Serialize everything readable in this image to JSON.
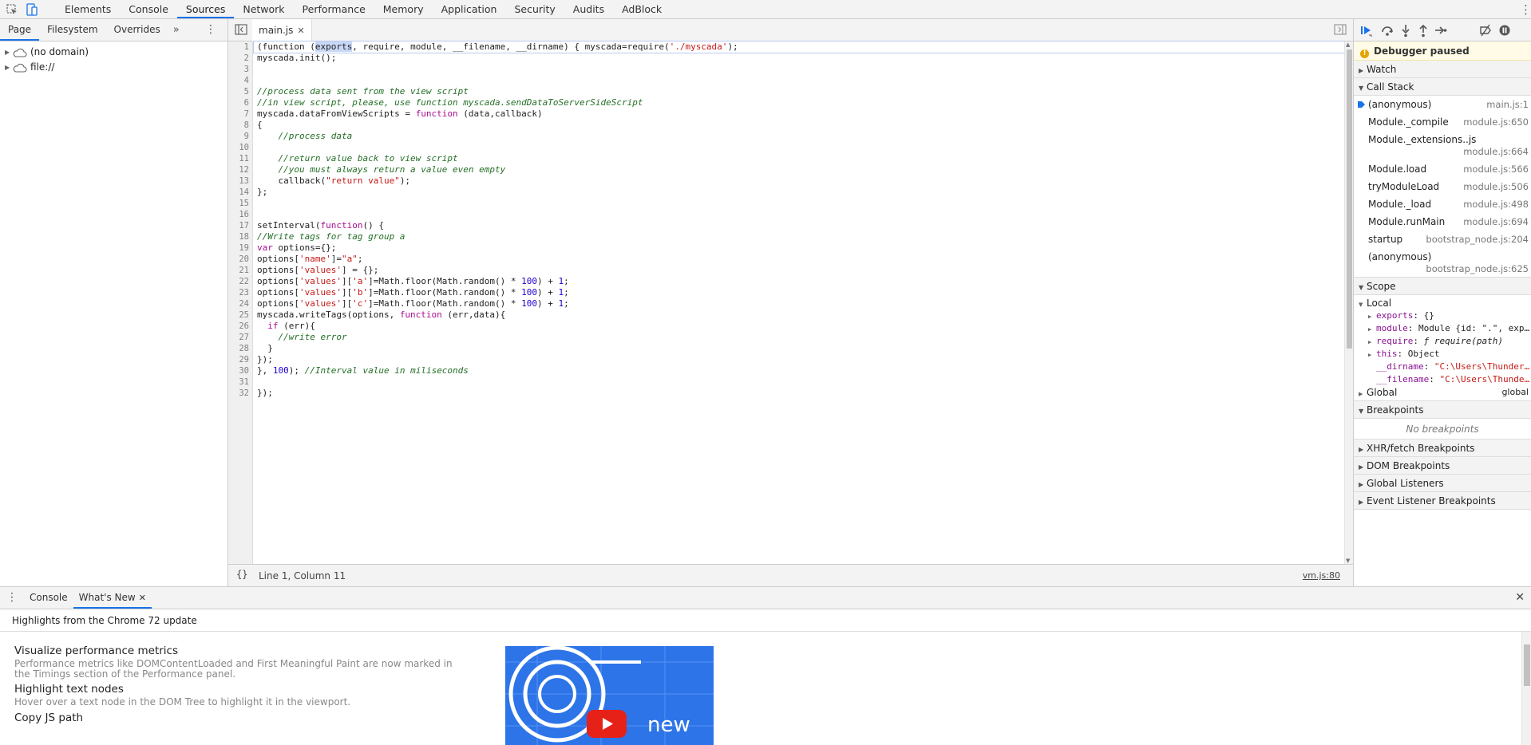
{
  "toolbar": {
    "tabs": [
      "Elements",
      "Console",
      "Sources",
      "Network",
      "Performance",
      "Memory",
      "Application",
      "Security",
      "Audits",
      "AdBlock"
    ],
    "active_tab": "Sources",
    "icons": [
      "inspect-element-icon",
      "device-toolbar-icon",
      "kebab-menu-icon"
    ]
  },
  "navigator": {
    "tabs": [
      "Page",
      "Filesystem",
      "Overrides"
    ],
    "more": "»",
    "items": [
      "(no domain)",
      "file://"
    ]
  },
  "editor": {
    "file_tab": "main.js",
    "status_position": "Line 1, Column 11",
    "status_braces": "{}",
    "status_link": "vm.js:80",
    "line_numbers": [
      "1",
      "2",
      "3",
      "4",
      "5",
      "6",
      "7",
      "8",
      "9",
      "10",
      "11",
      "12",
      "13",
      "14",
      "15",
      "16",
      "17",
      "18",
      "19",
      "20",
      "21",
      "22",
      "23",
      "24",
      "25",
      "26",
      "27",
      "28",
      "29",
      "30",
      "31",
      "32"
    ]
  },
  "code": {
    "l1a": "(function (",
    "l1sel": "exports",
    "l1b": ", require, module, __filename, __dirname) { myscada=require(",
    "l1str": "'./myscada'",
    "l1c": ");",
    "l2": "myscada.init();",
    "l5": "//process data sent from the view script",
    "l6": "//in view script, please, use function myscada.sendDataToServerSideScript",
    "l7a": "myscada.dataFromViewScripts = ",
    "l7kw": "function",
    "l7b": " (data,callback)",
    "l8": "{",
    "l9": "    //process data",
    "l11": "    //return value back to view script",
    "l12": "    //you must always return a value even empty",
    "l13a": "    callback(",
    "l13str": "\"return value\"",
    "l13b": ");",
    "l14": "};",
    "l17a": "setInterval(",
    "l17kw": "function",
    "l17b": "() {",
    "l18": "//Write tags for tag group a",
    "l19kw": "var",
    "l19b": " options={};",
    "l20a": "options[",
    "l20s1": "'name'",
    "l20b": "]=",
    "l20s2": "\"a\"",
    "l20c": ";",
    "l21a": "options[",
    "l21s": "'values'",
    "l21b": "] = {};",
    "l22a": "options[",
    "l22s1": "'values'",
    "l22b": "][",
    "l22s2": "'a'",
    "l22c": "]=Math.floor(Math.random() * ",
    "l22n1": "100",
    "l22d": ") + ",
    "l22n2": "1",
    "l22e": ";",
    "l23s2": "'b'",
    "l24s2": "'c'",
    "l25a": "myscada.writeTags(options, ",
    "l25kw": "function",
    "l25b": " (err,data){",
    "l26a": "  ",
    "l26kw": "if",
    "l26b": " (err){",
    "l27": "    //write error",
    "l28": "  }",
    "l29": "});",
    "l30a": "}, ",
    "l30n": "100",
    "l30b": "); ",
    "l30c": "//Interval value in miliseconds",
    "l32": "});"
  },
  "debugger": {
    "paused": "Debugger paused",
    "sections": {
      "watch": "Watch",
      "call_stack": "Call Stack",
      "scope": "Scope",
      "breakpoints": "Breakpoints",
      "xhr": "XHR/fetch Breakpoints",
      "dom": "DOM Breakpoints",
      "global_listeners": "Global Listeners",
      "event_listeners": "Event Listener Breakpoints"
    },
    "call_stack": [
      {
        "name": "(anonymous)",
        "loc": "main.js:1"
      },
      {
        "name": "Module._compile",
        "loc": "module.js:650"
      },
      {
        "name": "Module._extensions..js",
        "loc": "module.js:664"
      },
      {
        "name": "Module.load",
        "loc": "module.js:566"
      },
      {
        "name": "tryModuleLoad",
        "loc": "module.js:506"
      },
      {
        "name": "Module._load",
        "loc": "module.js:498"
      },
      {
        "name": "Module.runMain",
        "loc": "module.js:694"
      },
      {
        "name": "startup",
        "loc": "bootstrap_node.js:204"
      },
      {
        "name": "(anonymous)",
        "loc": "bootstrap_node.js:625"
      }
    ],
    "scope": {
      "local": "Local",
      "exports_name": "exports",
      "exports_val": "{}",
      "module_name": "module",
      "module_val": "Module {id: \".\", exp…",
      "require_name": "require",
      "require_val": "ƒ require(path)",
      "this_name": "this",
      "this_val": "Object",
      "dirname_name": "__dirname",
      "dirname_val": "\"C:\\Users\\Thunder…",
      "filename_name": "__filename",
      "filename_val": "\"C:\\Users\\Thunde…",
      "global": "Global",
      "global_val": "global"
    },
    "no_breakpoints": "No breakpoints"
  },
  "drawer": {
    "tabs": [
      "Console",
      "What's New"
    ],
    "active": "What's New",
    "header": "Highlights from the Chrome 72 update",
    "items": [
      {
        "title": "Visualize performance metrics",
        "desc": "Performance metrics like DOMContentLoaded and First Meaningful Paint are now marked in the Timings section of the Performance panel."
      },
      {
        "title": "Highlight text nodes",
        "desc": "Hover over a text node in the DOM Tree to highlight it in the viewport."
      },
      {
        "title": "Copy JS path",
        "desc": ""
      }
    ],
    "video_text": "new"
  },
  "colors": {
    "accent": "#1a73e8",
    "debug_blue": "#1a73e8",
    "youtube_red": "#e62117",
    "thumb_blue": "#2d74e8"
  }
}
